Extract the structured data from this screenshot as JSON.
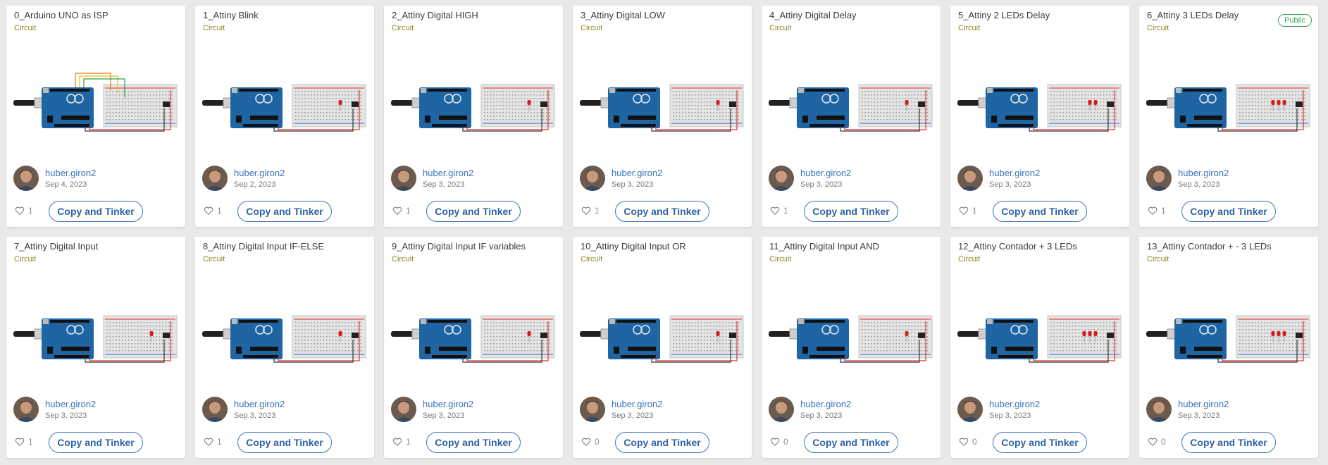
{
  "colors": {
    "author_link": "#3b73b9",
    "circuit_label": "#8a8a23",
    "public_badge": "#3aa35a",
    "button_border": "#3b73b9",
    "page_background": "#e9e9e9"
  },
  "cards": [
    {
      "title": "0_Arduino UNO as ISP",
      "type": "Circuit",
      "author": "huber.giron2",
      "date": "Sep 4, 2023",
      "likes": "1",
      "button": "Copy and Tinker",
      "badge": "",
      "leds": 0,
      "isp": true
    },
    {
      "title": "1_Attiny Blink",
      "type": "Circuit",
      "author": "huber.giron2",
      "date": "Sep 2, 2023",
      "likes": "1",
      "button": "Copy and Tinker",
      "badge": "",
      "leds": 1,
      "isp": false
    },
    {
      "title": "2_Attiny Digital HIGH",
      "type": "Circuit",
      "author": "huber.giron2",
      "date": "Sep 3, 2023",
      "likes": "1",
      "button": "Copy and Tinker",
      "badge": "",
      "leds": 1,
      "isp": false
    },
    {
      "title": "3_Attiny Digital LOW",
      "type": "Circuit",
      "author": "huber.giron2",
      "date": "Sep 3, 2023",
      "likes": "1",
      "button": "Copy and Tinker",
      "badge": "",
      "leds": 1,
      "isp": false
    },
    {
      "title": "4_Attiny Digital Delay",
      "type": "Circuit",
      "author": "huber.giron2",
      "date": "Sep 3, 2023",
      "likes": "1",
      "button": "Copy and Tinker",
      "badge": "",
      "leds": 1,
      "isp": false
    },
    {
      "title": "5_Attiny 2 LEDs Delay",
      "type": "Circuit",
      "author": "huber.giron2",
      "date": "Sep 3, 2023",
      "likes": "1",
      "button": "Copy and Tinker",
      "badge": "",
      "leds": 2,
      "isp": false
    },
    {
      "title": "6_Attiny 3 LEDs Delay",
      "type": "Circuit",
      "author": "huber.giron2",
      "date": "Sep 3, 2023",
      "likes": "1",
      "button": "Copy and Tinker",
      "badge": "Public",
      "leds": 3,
      "isp": false
    },
    {
      "title": "7_Attiny Digital Input",
      "type": "Circuit",
      "author": "huber.giron2",
      "date": "Sep 3, 2023",
      "likes": "1",
      "button": "Copy and Tinker",
      "badge": "",
      "leds": 1,
      "isp": false
    },
    {
      "title": "8_Attiny Digital Input IF-ELSE",
      "type": "Circuit",
      "author": "huber.giron2",
      "date": "Sep 3, 2023",
      "likes": "1",
      "button": "Copy and Tinker",
      "badge": "",
      "leds": 1,
      "isp": false
    },
    {
      "title": "9_Attiny Digital Input IF variables",
      "type": "Circuit",
      "author": "huber.giron2",
      "date": "Sep 3, 2023",
      "likes": "1",
      "button": "Copy and Tinker",
      "badge": "",
      "leds": 1,
      "isp": false
    },
    {
      "title": "10_Attiny Digital Input OR",
      "type": "Circuit",
      "author": "huber.giron2",
      "date": "Sep 3, 2023",
      "likes": "0",
      "button": "Copy and Tinker",
      "badge": "",
      "leds": 1,
      "isp": false
    },
    {
      "title": "11_Attiny Digital Input AND",
      "type": "Circuit",
      "author": "huber.giron2",
      "date": "Sep 3, 2023",
      "likes": "0",
      "button": "Copy and Tinker",
      "badge": "",
      "leds": 1,
      "isp": false
    },
    {
      "title": "12_Attiny Contador + 3 LEDs",
      "type": "Circuit",
      "author": "huber.giron2",
      "date": "Sep 3, 2023",
      "likes": "0",
      "button": "Copy and Tinker",
      "badge": "",
      "leds": 3,
      "isp": false
    },
    {
      "title": "13_Attiny Contador + - 3 LEDs",
      "type": "Circuit",
      "author": "huber.giron2",
      "date": "Sep 3, 2023",
      "likes": "0",
      "button": "Copy and Tinker",
      "badge": "",
      "leds": 3,
      "isp": false
    }
  ]
}
